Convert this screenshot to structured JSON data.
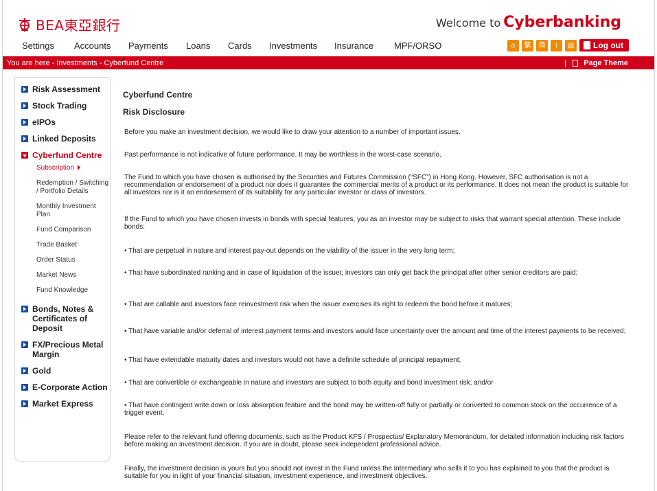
{
  "brand": {
    "logo_text": "BEA東亞銀行",
    "welcome_prefix": "Welcome to",
    "welcome_brand": "Cyberbanking"
  },
  "nav": [
    "Settings",
    "Accounts",
    "Payments",
    "Loans",
    "Cards",
    "Investments",
    "Insurance",
    "MPF/ORSO"
  ],
  "tools": {
    "icons": [
      "home-icon",
      "traditional-chinese-icon",
      "simplified-chinese-icon",
      "info-icon",
      "print-icon"
    ],
    "glyphs": [
      "⌂",
      "繁",
      "简",
      "i",
      "▤"
    ],
    "logout_label": "Log out"
  },
  "breadcrumb": {
    "text": "You are here - Investments - Cyberfund Centre",
    "separator": "|",
    "page_theme": "Page Theme"
  },
  "sidebar": {
    "items": [
      {
        "label": "Risk Assessment"
      },
      {
        "label": "Stock Trading"
      },
      {
        "label": "eIPOs"
      },
      {
        "label": "Linked Deposits"
      },
      {
        "label": "Cyberfund Centre"
      },
      {
        "label": "Bonds, Notes & Certificates of Deposit"
      },
      {
        "label": "FX/Precious Metal Margin"
      },
      {
        "label": "Gold"
      },
      {
        "label": "E-Corporate Action"
      },
      {
        "label": "Market Express"
      }
    ],
    "sub_items": [
      {
        "label": "Subscription"
      },
      {
        "label": "Redemption / Switching / Portfolio Details"
      },
      {
        "label": "Monthly Investment Plan"
      },
      {
        "label": "Fund Comparison"
      },
      {
        "label": "Trade Basket"
      },
      {
        "label": "Order Status"
      },
      {
        "label": "Market News"
      },
      {
        "label": "Fund Knowledge"
      }
    ]
  },
  "content": {
    "title": "Cyberfund Centre",
    "subtitle": "Risk Disclosure",
    "intro": "Before you make an investment decision, we would like to draw your attention to a number of important issues.",
    "p1": "Past performance is not indicative of future performance. It may be worthless in the worst-case scenario.",
    "p2": "The Fund to which you have chosen is authorised by the Securities and Futures Commission (“SFC”) in Hong Kong. However, SFC authorisation is not a recommendation or endorsement of a product nor does it guarantee the commercial merits of a product or its performance. It does not mean the product is suitable for all investors nor is it an endorsement of its suitability for any particular investor or class of investors.",
    "p3": "If the Fund to which you have chosen invests in bonds with special features, you as an investor may be subject to risks that warrant special attention. These include bonds:",
    "bullets": [
      "• That are perpetual in nature and interest pay-out depends on the viability of the issuer in the very long term;",
      "• That have subordinated ranking and in case of liquidation of the issuer, investors can only get back the principal after other senior creditors are paid;",
      "• That are callable and investors face reinvestment risk when the issuer exercises its right to redeem the bond before it matures;",
      "• That have variable and/or deferral of interest payment terms and investors would face uncertainty over the amount and time of the interest payments to be received;",
      "• That have extendable maturity dates and investors would not have a definite schedule of principal repayment;",
      "• That are convertible or exchangeable in nature and investors are subject to both equity and bond investment risk; and/or",
      "• That have contingent write down or loss absorption feature and the bond may be written-off fully or partially or converted to common stock on the occurrence of a trigger event."
    ],
    "p4": "Please refer to the relevant fund offering documents, such as the Product KFS / Prospectus/ Explanatory Memorandum, for detailed information including risk factors before making an investment decision. If you are in doubt, please seek independent professional advice.",
    "p5": "Finally, the investment decision is yours but you should not invest in the Fund unless the intermediary who sells it to you has explained to you that the product is suitable for you in light of your financial situation, investment experience, and investment objectives."
  },
  "colors": {
    "brand_red": "#d0021b",
    "tool_orange": "#f08a00",
    "nav_blue": "#1a4fa0"
  }
}
